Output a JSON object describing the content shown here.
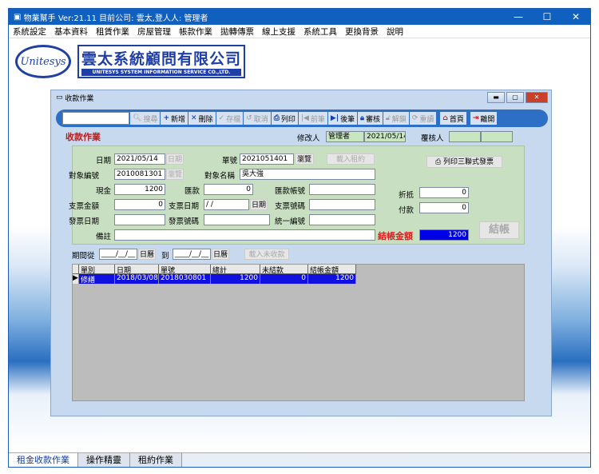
{
  "app": {
    "title": "物業幫手  Ver:21.11 目前公司: 雲太,登人人: 管理者",
    "menu": [
      "系統設定",
      "基本資料",
      "租賃作業",
      "房屋管理",
      "帳款作業",
      "拋轉傳票",
      "線上支援",
      "系統工具",
      "更換背景",
      "說明"
    ],
    "logo": {
      "mark": "Unitesys",
      "name_zh": "雲太系統顧問有限公司",
      "name_en": "UNITESYS SYSTEM INFORMATION SERVICE CO.,LTD."
    }
  },
  "window": {
    "title": "收款作業",
    "toolbar": {
      "search_value": "",
      "search": "搜尋",
      "add": "新增",
      "delete": "刪除",
      "save": "存檔",
      "cancel": "取消",
      "print": "列印",
      "prev": "前筆",
      "next": "後筆",
      "audit": "審核",
      "unlock": "解鎖",
      "reload": "重讀",
      "home": "首頁",
      "exit": "離開"
    },
    "heading": "收款作業",
    "modifier_label": "修改人",
    "modifier": "管理者",
    "modified_date": "2021/05/14",
    "auditor_label": "覆核人",
    "auditor": "",
    "audit_date": "",
    "form": {
      "date_label": "日期",
      "date": "2021/05/14",
      "date_btn": "日期",
      "no_label": "單號",
      "no": "2021051401",
      "browse": "瀏覽",
      "load_contract": "載入租約",
      "obj_no_label": "對象編號",
      "obj_no": "2010081301",
      "obj_browse": "瀏覽",
      "obj_name_label": "對象名稱",
      "obj_name": "吳大強",
      "cash_label": "現金",
      "cash": "1200",
      "remit_label": "匯款",
      "remit": "0",
      "remit_acct_label": "匯款帳號",
      "remit_acct": "",
      "check_amt_label": "支票金額",
      "check_amt": "0",
      "check_date_label": "支票日期",
      "check_date": " / /",
      "check_date_btn": "日期",
      "check_no_label": "支票號碼",
      "check_no": "",
      "inv_date_label": "發票日期",
      "inv_date": "",
      "inv_no_label": "發票號碼",
      "inv_no": "",
      "tax_id_label": "統一編號",
      "tax_id": "",
      "note_label": "備註",
      "note": "",
      "print_invoice": "列印三聯式發票",
      "discount_label": "折抵",
      "discount": "0",
      "pay_label": "付款",
      "pay": "0",
      "settle_amt_label": "結帳金額",
      "settle_amt": "1200",
      "settle_btn": "結帳"
    },
    "period": {
      "from_label": "期間從",
      "from": "____/__/__",
      "cal1": "日曆",
      "to_label": "到",
      "to": "____/__/__",
      "cal2": "日曆",
      "load_unpaid": "載入未收款"
    },
    "grid": {
      "columns": [
        "單別",
        "日期",
        "單號",
        "總計",
        "未結款",
        "結帳金額"
      ],
      "rows": [
        [
          "修繕",
          "2018/03/08",
          "2018030801",
          "1200",
          "0",
          "1200"
        ]
      ]
    }
  },
  "tabs": [
    "租金收款作業",
    "操作精靈",
    "租約作業"
  ]
}
